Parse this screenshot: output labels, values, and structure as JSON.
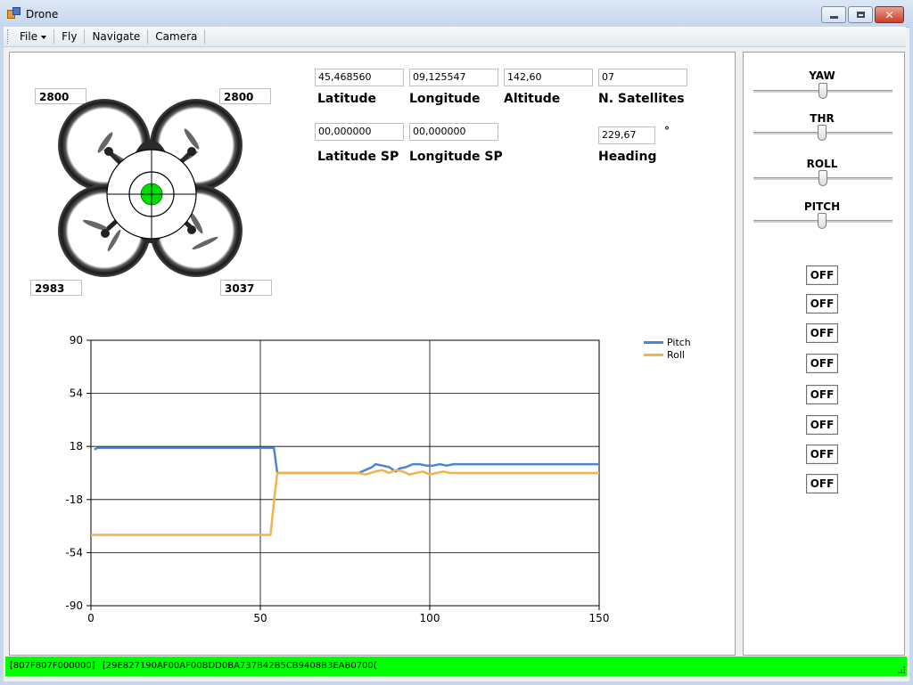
{
  "window": {
    "title": "Drone"
  },
  "menu": [
    "File",
    "Fly",
    "Navigate",
    "Camera"
  ],
  "motors": {
    "front_left": "2800",
    "front_right": "2800",
    "rear_left": "2983",
    "rear_right": "3037"
  },
  "gps": {
    "latitude": "45,468560",
    "latitude_label": "Latitude",
    "longitude": "09,125547",
    "longitude_label": "Longitude",
    "altitude": "142,60",
    "altitude_label": "Altitude",
    "satellites": "07",
    "satellites_label": "N. Satellites",
    "latitude_sp": "00,000000",
    "latitude_sp_label": "Latitude SP",
    "longitude_sp": "00,000000",
    "longitude_sp_label": "Longitude SP",
    "heading": "229,67",
    "heading_label": "Heading",
    "heading_unit": "°"
  },
  "sliders": [
    {
      "label": "YAW",
      "value": 0.5
    },
    {
      "label": "THR",
      "value": 0.49
    },
    {
      "label": "ROLL",
      "value": 0.5
    },
    {
      "label": "PITCH",
      "value": 0.49
    }
  ],
  "toggles": [
    "OFF",
    "OFF",
    "OFF",
    "OFF",
    "OFF",
    "OFF",
    "OFF",
    "OFF"
  ],
  "status": {
    "field1": "[807F807F000000]",
    "field2": "[29E827190AF00AF00BDD0BA737B42B5CB9408B3EAB0700("
  },
  "colors": {
    "pitch": "#4a86d4",
    "roll": "#f5b14a",
    "status_bg": "#00ff00",
    "center": "#00dd00"
  },
  "chart_data": {
    "type": "line",
    "xlim": [
      0,
      150
    ],
    "ylim": [
      -90,
      90
    ],
    "xticks": [
      "0",
      "50",
      "100",
      "150"
    ],
    "yticks": [
      "90",
      "54",
      "18",
      "-18",
      "-54",
      "-90"
    ],
    "grid": true,
    "legend_position": "top-right",
    "series": [
      {
        "name": "Pitch",
        "color": "#4a86d4",
        "x": [
          1,
          2,
          30,
          53,
          54,
          55,
          60,
          70,
          79,
          81,
          83,
          84,
          86,
          88,
          90,
          91,
          93,
          95,
          97,
          99,
          100,
          101,
          103,
          105,
          107,
          110,
          130,
          150
        ],
        "y": [
          16,
          17,
          17,
          17,
          17,
          0,
          0,
          0,
          0,
          2,
          4,
          6,
          5,
          4,
          1,
          3,
          4,
          6,
          6,
          5,
          5,
          5,
          6,
          5,
          6,
          6,
          6,
          6
        ]
      },
      {
        "name": "Roll",
        "color": "#f5b14a",
        "x": [
          0,
          10,
          30,
          53,
          54,
          55,
          60,
          70,
          79,
          81,
          84,
          86,
          88,
          89,
          90,
          92,
          94,
          96,
          98,
          100,
          102,
          104,
          106,
          110,
          130,
          150
        ],
        "y": [
          -42,
          -42,
          -42,
          -42,
          -20,
          0,
          0,
          0,
          0,
          -1,
          1,
          2,
          0,
          1,
          2,
          1,
          -1,
          0,
          1,
          -1,
          0,
          1,
          0,
          0,
          0,
          0
        ]
      }
    ]
  }
}
